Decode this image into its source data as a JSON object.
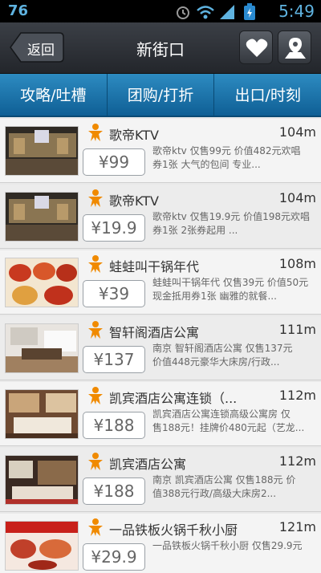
{
  "status_bar": {
    "left_number": "76",
    "time": "5:49"
  },
  "header": {
    "back_label": "返回",
    "title": "新街口"
  },
  "tabs": [
    {
      "label": "攻略/吐槽"
    },
    {
      "label": "团购/打折"
    },
    {
      "label": "出口/时刻"
    }
  ],
  "colors": {
    "tab_blue": "#1a76b1",
    "accent_orange": "#f08a00"
  },
  "list": [
    {
      "name": "歌帝KTV",
      "distance": "104m",
      "price": "¥99",
      "desc1": "歌帝ktv 仅售99元 价值482元欢唱",
      "desc2": "券1张 大气的包间 专业..."
    },
    {
      "name": "歌帝KTV",
      "distance": "104m",
      "price": "¥19.9",
      "desc1": "歌帝ktv 仅售19.9元 价值198元欢唱",
      "desc2": "券1张 2张券起用 ..."
    },
    {
      "name": "蛙蛙叫干锅年代",
      "distance": "108m",
      "price": "¥39",
      "desc1": "蛙蛙叫干锅年代 仅售39元 价值50元",
      "desc2": "现金抵用券1张 幽雅的就餐..."
    },
    {
      "name": "智轩阁酒店公寓",
      "distance": "111m",
      "price": "¥137",
      "desc1": "南京   智轩阁酒店公寓 仅售137元",
      "desc2": "价值448元豪华大床房/行政..."
    },
    {
      "name": "凯宾酒店公寓连锁（...",
      "distance": "112m",
      "price": "¥188",
      "desc1": "凯宾酒店公寓连锁高级公寓房 仅",
      "desc2": "售188元！挂牌价480元起（艺龙..."
    },
    {
      "name": "凯宾酒店公寓",
      "distance": "112m",
      "price": "¥188",
      "desc1": "南京   凯宾酒店公寓 仅售188元 价",
      "desc2": "值388元行政/高级大床房2..."
    },
    {
      "name": "一品铁板火锅千秋小厨",
      "distance": "121m",
      "price": "¥29.9",
      "desc1": "一品铁板火锅千秋小厨 仅售29.9元",
      "desc2": ""
    }
  ]
}
